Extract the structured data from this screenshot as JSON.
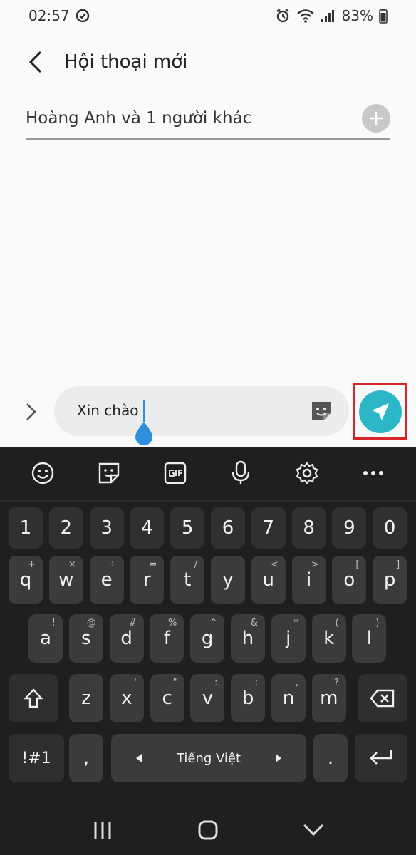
{
  "status_bar": {
    "time": "02:57",
    "battery": "83%"
  },
  "header": {
    "title": "Hội thoại mới"
  },
  "recipients": {
    "text": "Hoàng Anh và 1 người khác"
  },
  "composer": {
    "message": "Xin chào"
  },
  "keyboard": {
    "number_row": [
      "1",
      "2",
      "3",
      "4",
      "5",
      "6",
      "7",
      "8",
      "9",
      "0"
    ],
    "row1": [
      {
        "k": "q",
        "h": "+"
      },
      {
        "k": "w",
        "h": "×"
      },
      {
        "k": "e",
        "h": "÷"
      },
      {
        "k": "r",
        "h": "="
      },
      {
        "k": "t",
        "h": "/"
      },
      {
        "k": "y",
        "h": "_"
      },
      {
        "k": "u",
        "h": "<"
      },
      {
        "k": "i",
        "h": ">"
      },
      {
        "k": "o",
        "h": "["
      },
      {
        "k": "p",
        "h": "]"
      }
    ],
    "row2": [
      {
        "k": "a",
        "h": "!"
      },
      {
        "k": "s",
        "h": "@"
      },
      {
        "k": "d",
        "h": "#"
      },
      {
        "k": "f",
        "h": "%"
      },
      {
        "k": "g",
        "h": "^"
      },
      {
        "k": "h",
        "h": "&"
      },
      {
        "k": "j",
        "h": "*"
      },
      {
        "k": "k",
        "h": "("
      },
      {
        "k": "l",
        "h": ")"
      }
    ],
    "row3": [
      {
        "k": "z",
        "h": "-"
      },
      {
        "k": "x",
        "h": "'"
      },
      {
        "k": "c",
        "h": "\""
      },
      {
        "k": "v",
        "h": ":"
      },
      {
        "k": "b",
        "h": ";"
      },
      {
        "k": "n",
        "h": ","
      },
      {
        "k": "m",
        "h": "?"
      }
    ],
    "symbols_label": "!#1",
    "comma_label": ",",
    "space_label": "Tiếng Việt",
    "period_label": "."
  }
}
